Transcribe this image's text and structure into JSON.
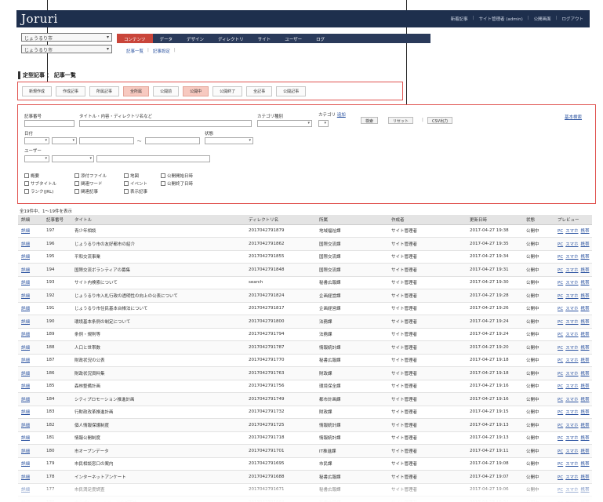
{
  "header": {
    "logo": "Joruri",
    "links": [
      "新着記事",
      "サイト管理者 (admin)",
      "公開画面",
      "ログアウト"
    ]
  },
  "nav": {
    "site_select": "じょうるり市",
    "group_select": "じょうるり市",
    "menu": [
      "コンテンツ",
      "データ",
      "デザイン",
      "ディレクトリ",
      "サイト",
      "ユーザー",
      "ログ"
    ],
    "active_menu": "コンテンツ",
    "sublinks": [
      "記事一覧",
      "記事設定"
    ]
  },
  "page_title": "定型記事 ： 記事一覧",
  "buttons": [
    {
      "label": "新規作成",
      "highlight": false
    },
    {
      "label": "作成記事",
      "highlight": false
    },
    {
      "label": "所属記事",
      "highlight": false
    },
    {
      "label": "全所属",
      "highlight": true
    },
    {
      "label": "公開前",
      "highlight": false
    },
    {
      "label": "公開中",
      "highlight": true
    },
    {
      "label": "公開終了",
      "highlight": false
    },
    {
      "label": "全記事",
      "highlight": false
    },
    {
      "label": "公開記事",
      "highlight": false
    }
  ],
  "search": {
    "label_docno": "記事番号",
    "label_title": "タイトル・内容・ディレクトリ名など",
    "label_cattype": "カテゴリ種別",
    "label_category": "カテゴリ",
    "add_link": "追加",
    "search_button": "検索",
    "reset_button": "リセット",
    "csv_button": "CSV出力",
    "basic_search_link": "基本検索",
    "label_date": "日付",
    "tilde": "〜",
    "label_status": "状態",
    "label_user": "ユーザー",
    "checkboxes": [
      "概要",
      "添付ファイル",
      "地図",
      "公開開始日時",
      "サブタイトル",
      "関連ワード",
      "イベント",
      "公開終了日時",
      "ランク(JRL)",
      "関連記事",
      "表示記事"
    ]
  },
  "table": {
    "count_text": "全19件中、1〜19件を表示",
    "columns": [
      "詳細",
      "記事番号",
      "タイトル",
      "ディレクトリ名",
      "所属",
      "作成者",
      "更新日時",
      "状態",
      "プレビュー"
    ],
    "detail_label": "詳細",
    "preview_links": [
      "PC",
      "スマホ",
      "携帯"
    ],
    "rows": [
      {
        "no": "197",
        "title": "青少年相談",
        "dir": "2017042791879",
        "dept": "地域福祉課",
        "author": "サイト管理者",
        "date": "2017-04-27 19:38",
        "status": "公開中"
      },
      {
        "no": "196",
        "title": "じょうるり市の友好都市の紹介",
        "dir": "2017042791862",
        "dept": "国際交流課",
        "author": "サイト管理者",
        "date": "2017-04-27 19:35",
        "status": "公開中"
      },
      {
        "no": "195",
        "title": "平和交流事業",
        "dir": "2017042791855",
        "dept": "国際交流課",
        "author": "サイト管理者",
        "date": "2017-04-27 19:34",
        "status": "公開中"
      },
      {
        "no": "194",
        "title": "国際交流ボランティアの募集",
        "dir": "2017042791848",
        "dept": "国際交流課",
        "author": "サイト管理者",
        "date": "2017-04-27 19:31",
        "status": "公開中"
      },
      {
        "no": "193",
        "title": "サイト内検索について",
        "dir": "search",
        "dept": "秘書広報課",
        "author": "サイト管理者",
        "date": "2017-04-27 19:30",
        "status": "公開中"
      },
      {
        "no": "192",
        "title": "じょうるり市入札行政の透明性の向上の公表について",
        "dir": "2017042791824",
        "dept": "企画経営課",
        "author": "サイト管理者",
        "date": "2017-04-27 19:28",
        "status": "公開中"
      },
      {
        "no": "191",
        "title": "じょうるり市住民基本台帳法について",
        "dir": "2017042791817",
        "dept": "企画経営課",
        "author": "サイト管理者",
        "date": "2017-04-27 19:26",
        "status": "公開中"
      },
      {
        "no": "190",
        "title": "環境基本条例の制定について",
        "dir": "2017042791800",
        "dept": "法務課",
        "author": "サイト管理者",
        "date": "2017-04-27 19:24",
        "status": "公開中"
      },
      {
        "no": "189",
        "title": "条例・規則等",
        "dir": "2017042791794",
        "dept": "法務課",
        "author": "サイト管理者",
        "date": "2017-04-27 19:24",
        "status": "公開中"
      },
      {
        "no": "188",
        "title": "人口と世帯数",
        "dir": "2017042791787",
        "dept": "情報統計課",
        "author": "サイト管理者",
        "date": "2017-04-27 19:20",
        "status": "公開中"
      },
      {
        "no": "187",
        "title": "財政状況の公表",
        "dir": "2017042791770",
        "dept": "秘書広報課",
        "author": "サイト管理者",
        "date": "2017-04-27 19:18",
        "status": "公開中"
      },
      {
        "no": "186",
        "title": "財政状況資料集",
        "dir": "2017042791763",
        "dept": "財政課",
        "author": "サイト管理者",
        "date": "2017-04-27 19:18",
        "status": "公開中"
      },
      {
        "no": "185",
        "title": "森林整備計画",
        "dir": "2017042791756",
        "dept": "環境保全課",
        "author": "サイト管理者",
        "date": "2017-04-27 19:16",
        "status": "公開中"
      },
      {
        "no": "184",
        "title": "シティプロモーション推進計画",
        "dir": "2017042791749",
        "dept": "都市計画課",
        "author": "サイト管理者",
        "date": "2017-04-27 19:16",
        "status": "公開中"
      },
      {
        "no": "183",
        "title": "行財政改革推進計画",
        "dir": "2017042791732",
        "dept": "財政課",
        "author": "サイト管理者",
        "date": "2017-04-27 19:15",
        "status": "公開中"
      },
      {
        "no": "182",
        "title": "個人情報保護制度",
        "dir": "2017042791725",
        "dept": "情報統計課",
        "author": "サイト管理者",
        "date": "2017-04-27 19:13",
        "status": "公開中"
      },
      {
        "no": "181",
        "title": "情報公開制度",
        "dir": "2017042791718",
        "dept": "情報統計課",
        "author": "サイト管理者",
        "date": "2017-04-27 19:13",
        "status": "公開中"
      },
      {
        "no": "180",
        "title": "市オープンデータ",
        "dir": "2017042791701",
        "dept": "IT推進課",
        "author": "サイト管理者",
        "date": "2017-04-27 19:11",
        "status": "公開中"
      },
      {
        "no": "179",
        "title": "市民相談窓口の案内",
        "dir": "2017042791695",
        "dept": "市民課",
        "author": "サイト管理者",
        "date": "2017-04-27 19:08",
        "status": "公開中"
      },
      {
        "no": "178",
        "title": "インターネットアンケート",
        "dir": "2017042791688",
        "dept": "秘書広報課",
        "author": "サイト管理者",
        "date": "2017-04-27 19:07",
        "status": "公開中"
      },
      {
        "no": "177",
        "title": "市民満足度調査",
        "dir": "2017042791671",
        "dept": "秘書広報課",
        "author": "サイト管理者",
        "date": "2017-04-27 19:06",
        "status": "公開中"
      },
      {
        "no": "176",
        "title": "市公式facebookページのご案内",
        "dir": "2017042791664",
        "dept": "秘書広報課",
        "author": "サイト管理者",
        "date": "2017-04-27 19:04",
        "status": "公開中"
      },
      {
        "no": "175",
        "title": "市報",
        "dir": "2017042791657",
        "dept": "秘書広報課",
        "author": "サイト管理者",
        "date": "2017-04-27 19:03",
        "status": "公開中"
      }
    ]
  }
}
